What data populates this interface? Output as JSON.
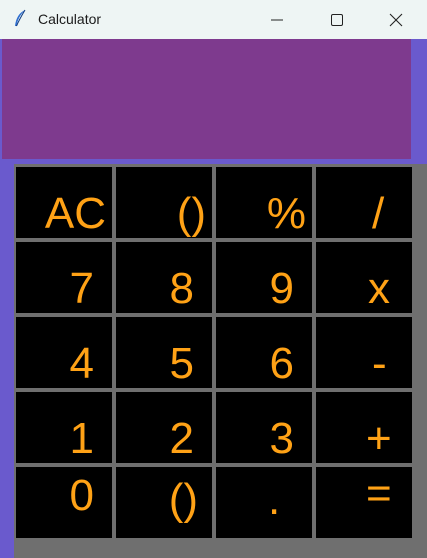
{
  "window": {
    "title": "Calculator",
    "minimize_label": "Minimize",
    "maximize_label": "Maximize",
    "close_label": "Close"
  },
  "display": {
    "value": ""
  },
  "keypad": {
    "rows": [
      [
        "AC",
        "()",
        "%",
        "/"
      ],
      [
        "7",
        "8",
        "9",
        "x"
      ],
      [
        "4",
        "5",
        "6",
        "-"
      ],
      [
        "1",
        "2",
        "3",
        "+"
      ],
      [
        "0",
        "()",
        ".",
        "="
      ]
    ]
  },
  "colors": {
    "window_background": "#6a5acd",
    "display_background": "#7e3a8e",
    "key_background": "#000000",
    "key_text": "#ffa216",
    "grid_lines": "#6f6f6f",
    "titlebar": "#eef5f4"
  }
}
